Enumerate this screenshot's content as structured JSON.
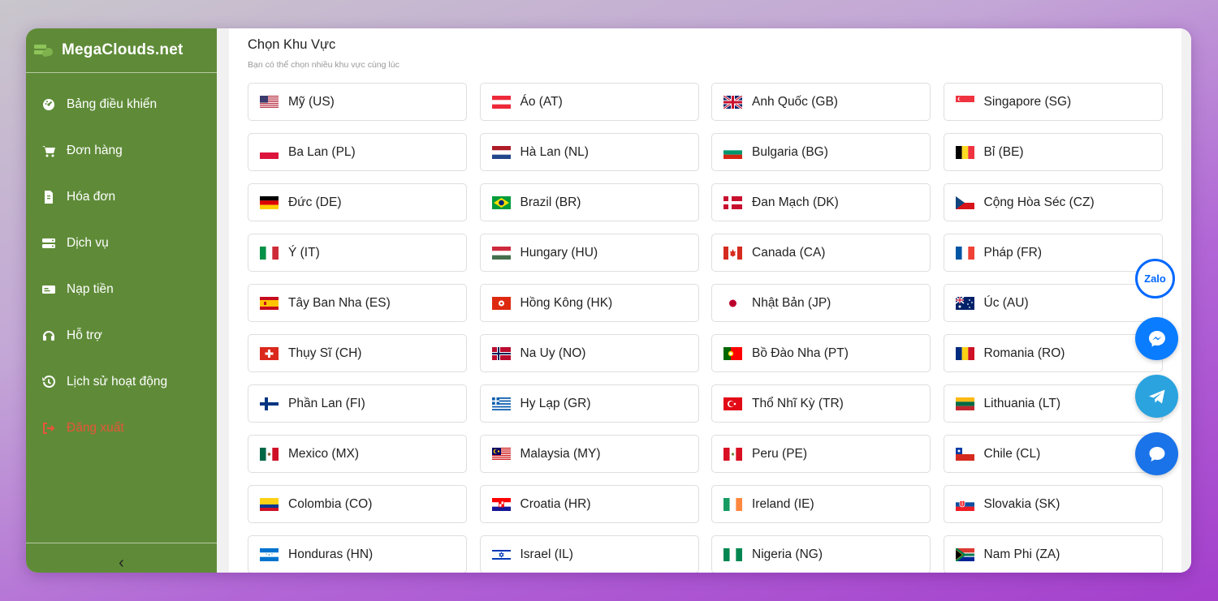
{
  "brand": {
    "name": "MegaClouds.net"
  },
  "sidebar": {
    "items": [
      {
        "label": "Bảng điều khiển",
        "icon": "dashboard-icon"
      },
      {
        "label": "Đơn hàng",
        "icon": "cart-icon"
      },
      {
        "label": "Hóa đơn",
        "icon": "invoice-icon"
      },
      {
        "label": "Dịch vụ",
        "icon": "server-icon"
      },
      {
        "label": "Nạp tiền",
        "icon": "money-icon"
      },
      {
        "label": "Hỗ trợ",
        "icon": "headset-icon"
      },
      {
        "label": "Lịch sử hoạt động",
        "icon": "history-icon"
      },
      {
        "label": "Đăng xuất",
        "icon": "logout-icon"
      }
    ],
    "collapse_icon": "chevron-left-icon"
  },
  "main": {
    "title": "Chọn Khu Vực",
    "subtitle": "Bạn có thể chọn nhiều khu vực cùng lúc"
  },
  "regions": [
    {
      "label": "Mỹ (US)",
      "code": "US"
    },
    {
      "label": "Áo (AT)",
      "code": "AT"
    },
    {
      "label": "Anh Quốc (GB)",
      "code": "GB"
    },
    {
      "label": "Singapore (SG)",
      "code": "SG"
    },
    {
      "label": "Ba Lan (PL)",
      "code": "PL"
    },
    {
      "label": "Hà Lan (NL)",
      "code": "NL"
    },
    {
      "label": "Bulgaria (BG)",
      "code": "BG"
    },
    {
      "label": "Bỉ (BE)",
      "code": "BE"
    },
    {
      "label": "Đức (DE)",
      "code": "DE"
    },
    {
      "label": "Brazil (BR)",
      "code": "BR"
    },
    {
      "label": "Đan Mạch (DK)",
      "code": "DK"
    },
    {
      "label": "Cộng Hòa Séc (CZ)",
      "code": "CZ"
    },
    {
      "label": "Ý (IT)",
      "code": "IT"
    },
    {
      "label": "Hungary (HU)",
      "code": "HU"
    },
    {
      "label": "Canada (CA)",
      "code": "CA"
    },
    {
      "label": "Pháp (FR)",
      "code": "FR"
    },
    {
      "label": "Tây Ban Nha (ES)",
      "code": "ES"
    },
    {
      "label": "Hồng Kông (HK)",
      "code": "HK"
    },
    {
      "label": "Nhật Bản (JP)",
      "code": "JP"
    },
    {
      "label": "Úc (AU)",
      "code": "AU"
    },
    {
      "label": "Thụy Sĩ (CH)",
      "code": "CH"
    },
    {
      "label": "Na Uy (NO)",
      "code": "NO"
    },
    {
      "label": "Bồ Đào Nha (PT)",
      "code": "PT"
    },
    {
      "label": "Romania (RO)",
      "code": "RO"
    },
    {
      "label": "Phần Lan (FI)",
      "code": "FI"
    },
    {
      "label": "Hy Lạp (GR)",
      "code": "GR"
    },
    {
      "label": "Thổ Nhĩ Kỳ (TR)",
      "code": "TR"
    },
    {
      "label": "Lithuania (LT)",
      "code": "LT"
    },
    {
      "label": "Mexico (MX)",
      "code": "MX"
    },
    {
      "label": "Malaysia (MY)",
      "code": "MY"
    },
    {
      "label": "Peru (PE)",
      "code": "PE"
    },
    {
      "label": "Chile (CL)",
      "code": "CL"
    },
    {
      "label": "Colombia (CO)",
      "code": "CO"
    },
    {
      "label": "Croatia (HR)",
      "code": "HR"
    },
    {
      "label": "Ireland (IE)",
      "code": "IE"
    },
    {
      "label": "Slovakia (SK)",
      "code": "SK"
    },
    {
      "label": "Honduras (HN)",
      "code": "HN"
    },
    {
      "label": "Israel (IL)",
      "code": "IL"
    },
    {
      "label": "Nigeria (NG)",
      "code": "NG"
    },
    {
      "label": "Nam Phi (ZA)",
      "code": "ZA"
    }
  ],
  "floating": {
    "zalo_label": "Zalo",
    "messenger_icon": "messenger-icon",
    "telegram_icon": "telegram-icon",
    "chat_icon": "chat-bubble-icon"
  },
  "colors": {
    "sidebar_bg": "#5f8b38",
    "logout_text": "#e8553a",
    "zalo": "#0068ff",
    "messenger": "#0a7cff",
    "telegram": "#2aa3df",
    "chat": "#1a73e8"
  }
}
